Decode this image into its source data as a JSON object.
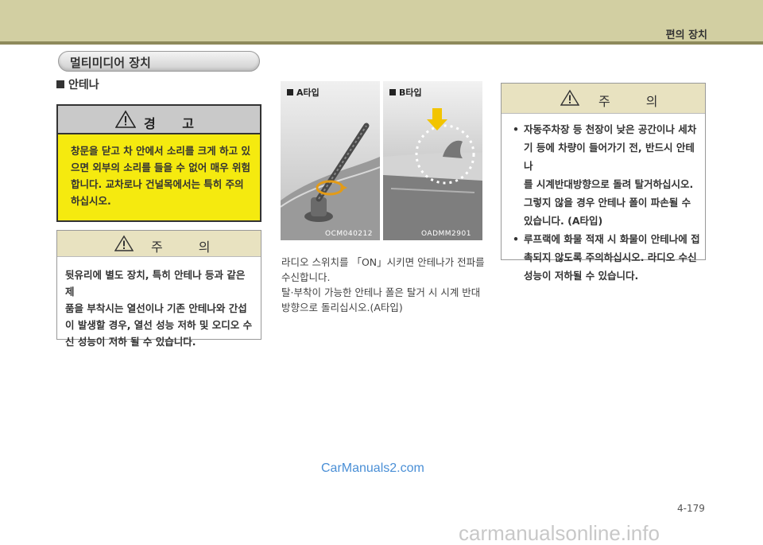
{
  "header": {
    "section_title": "편의 장치"
  },
  "section": {
    "title": "멀티미디어 장치"
  },
  "subsection": {
    "title": "안테나"
  },
  "warning": {
    "title": "경 고",
    "lines": [
      "창문을 닫고 차 안에서 소리를 크게 하고 있",
      "으면 외부의 소리를 들을 수 없어 매우 위험",
      "합니다. 교차로나 건널목에서는 특히 주의",
      "하십시오."
    ]
  },
  "caution1": {
    "title": "주 의",
    "lines": [
      "뒷유리에 별도 장치, 특히 안테나 등과 같은 제",
      "품을 부착시는 열선이나 기존 안테나와 간섭",
      "이 발생할 경우, 열선 성능 저하 및 오디오 수",
      "신 성능이 저하 될 수 있습니다."
    ]
  },
  "images": {
    "a": {
      "label": "A타입",
      "code": "OCM040212"
    },
    "b": {
      "label": "B타입",
      "code": "OADMM2901"
    }
  },
  "body_text": {
    "lines": [
      "라디오 스위치를 「ON」시키면 안테나가 전파를",
      "수신합니다.",
      "탈·부착이 가능한 안테나 폴은 탈거 시 시계 반대",
      "방향으로 돌리십시오.(A타입)"
    ]
  },
  "caution2": {
    "title": "주 의",
    "items": [
      [
        "자동주차장 등 천장이 낮은 공간이나 세차",
        "기 등에 차량이 들어가기 전, 반드시 안테나",
        "를 시계반대방향으로 돌려 탈거하십시오.",
        "그렇지 않을 경우 안테나 폴이 파손될 수",
        "있습니다. (A타입)"
      ],
      [
        "루프랙에 화물 적재 시 화물이 안테나에 접",
        "촉되지 않도록 주의하십시오. 라디오 수신",
        "성능이 저하될 수 있습니다."
      ]
    ]
  },
  "watermark": "CarManuals2.com",
  "page_number": "4-179",
  "footer_site": "carmanualsonline.info",
  "colors": {
    "header_band": "#d2cfa2",
    "warning_yellow": "#f5ea0f",
    "caution_header": "#e8e2c0",
    "watermark_blue": "#4a8fd6"
  }
}
